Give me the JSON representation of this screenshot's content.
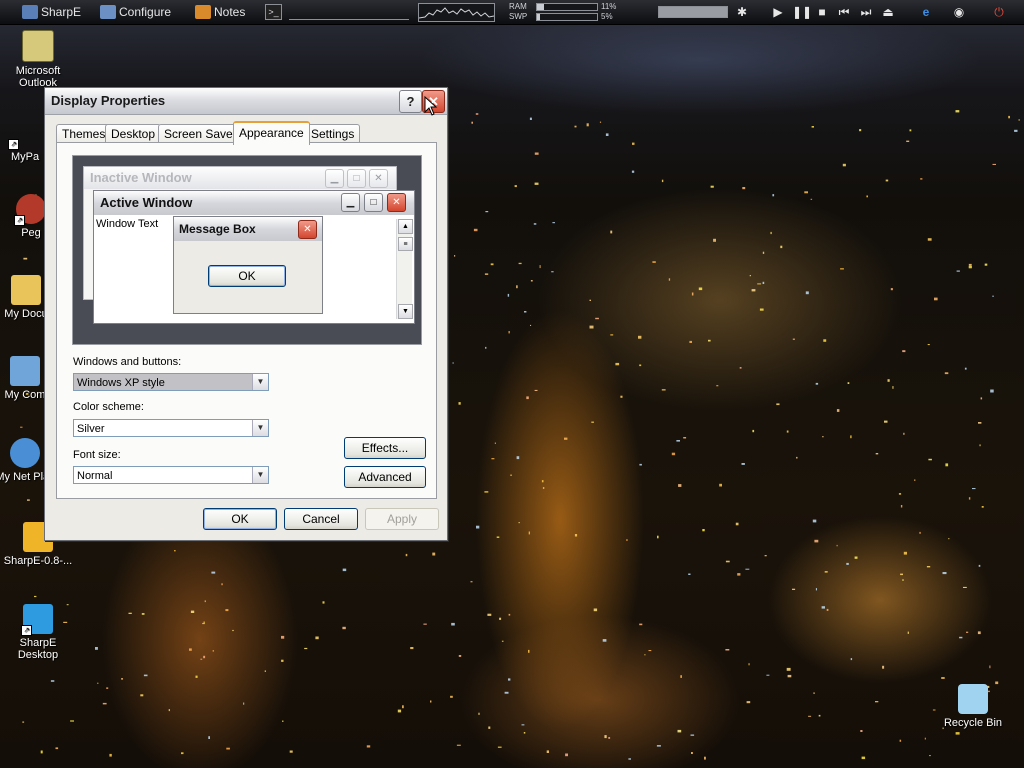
{
  "topbar": {
    "buttons": [
      {
        "label": "SharpE",
        "icon": "sharpe-icon"
      },
      {
        "label": "Configure",
        "icon": "configure-icon"
      },
      {
        "label": "Notes",
        "icon": "notes-icon"
      }
    ],
    "ram_label": "RAM",
    "swp_label": "SWP",
    "ram_percent": "11%",
    "swp_percent": "5%",
    "ram_value": 11,
    "swp_value": 5
  },
  "desktop_icons": [
    {
      "label": "Microsoft Outlook",
      "icon": "outlook-icon"
    },
    {
      "label": "MyPa",
      "icon": "folder-shortcut-icon"
    },
    {
      "label": "Peg",
      "icon": "app-shortcut-icon"
    },
    {
      "label": "My Docu",
      "icon": "my-documents-icon"
    },
    {
      "label": "My Com",
      "icon": "my-computer-icon"
    },
    {
      "label": "My Net Plac",
      "icon": "network-places-icon"
    },
    {
      "label": "SharpE-0.8-...",
      "icon": "installer-icon"
    },
    {
      "label": "SharpE Desktop",
      "icon": "sharpe-desktop-icon"
    },
    {
      "label": "Recycle Bin",
      "icon": "recycle-bin-icon"
    }
  ],
  "dialog": {
    "title": "Display Properties",
    "help_glyph": "?",
    "tabs": [
      {
        "label": "Themes"
      },
      {
        "label": "Desktop"
      },
      {
        "label": "Screen Saver"
      },
      {
        "label": "Appearance",
        "active": true
      },
      {
        "label": "Settings"
      }
    ],
    "preview": {
      "inactive_title": "Inactive Window",
      "active_title": "Active Window",
      "window_text": "Window Text",
      "message_title": "Message Box",
      "ok_label": "OK"
    },
    "windows_buttons_label": "Windows and buttons:",
    "windows_buttons_value": "Windows XP style",
    "color_scheme_label": "Color scheme:",
    "color_scheme_value": "Silver",
    "font_size_label": "Font size:",
    "font_size_value": "Normal",
    "effects_label": "Effects...",
    "advanced_label": "Advanced",
    "ok_label": "OK",
    "cancel_label": "Cancel",
    "apply_label": "Apply"
  }
}
